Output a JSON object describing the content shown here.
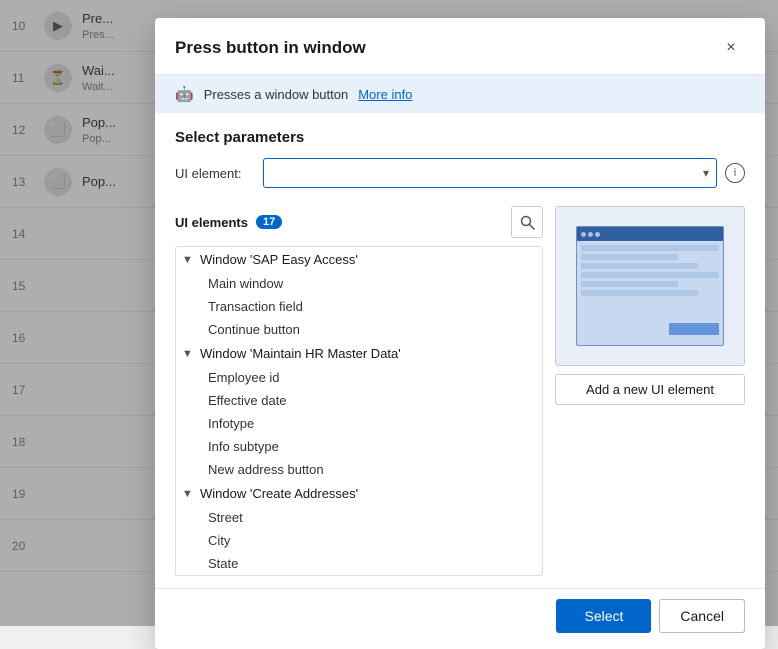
{
  "background": {
    "rows": [
      {
        "num": "10",
        "icon": "▶",
        "label": "Press button",
        "sub": "Pres..."
      },
      {
        "num": "11",
        "icon": "⏳",
        "label": "Wait",
        "sub": "Wait..."
      },
      {
        "num": "12",
        "icon": "⬜",
        "label": "Pop",
        "sub": "Pop..."
      },
      {
        "num": "13",
        "icon": "⬜",
        "label": "Pop",
        "sub": ""
      },
      {
        "num": "14",
        "icon": "",
        "label": "",
        "sub": ""
      },
      {
        "num": "15",
        "icon": "",
        "label": "",
        "sub": ""
      },
      {
        "num": "16",
        "icon": "",
        "label": "",
        "sub": ""
      },
      {
        "num": "17",
        "icon": "",
        "label": "",
        "sub": ""
      },
      {
        "num": "18",
        "icon": "",
        "label": "",
        "sub": ""
      },
      {
        "num": "19",
        "icon": "",
        "label": "",
        "sub": ""
      },
      {
        "num": "20",
        "icon": "",
        "label": "",
        "sub": ""
      }
    ]
  },
  "modal": {
    "title": "Press button in window",
    "close_label": "×",
    "info_text": "Presses a window button",
    "info_link": "More info",
    "section_title": "Select parameters",
    "ui_element_label": "UI element:",
    "ui_element_placeholder": "",
    "ui_elements_header": "UI elements",
    "ui_elements_count": "17",
    "search_icon": "🔍",
    "tree": {
      "groups": [
        {
          "label": "Window 'SAP Easy Access'",
          "children": [
            "Main window",
            "Transaction field",
            "Continue button"
          ]
        },
        {
          "label": "Window 'Maintain HR Master Data'",
          "children": [
            "Employee id",
            "Effective date",
            "Infotype",
            "Info subtype",
            "New address button"
          ]
        },
        {
          "label": "Window 'Create Addresses'",
          "children": [
            "Street",
            "City",
            "State"
          ]
        }
      ]
    },
    "add_ui_element_label": "Add a new UI element",
    "select_button": "Select",
    "cancel_button": "Cancel"
  }
}
